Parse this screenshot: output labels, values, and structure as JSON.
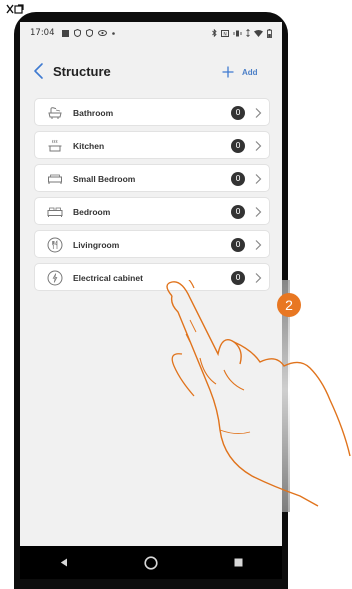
{
  "status_bar": {
    "time": "17:04"
  },
  "header": {
    "title": "Structure",
    "add_label": "Add"
  },
  "rooms": [
    {
      "label": "Bathroom",
      "count": "0",
      "icon": "bathtub-icon"
    },
    {
      "label": "Kitchen",
      "count": "0",
      "icon": "cooking-pot-icon"
    },
    {
      "label": "Small Bedroom",
      "count": "0",
      "icon": "single-bed-icon"
    },
    {
      "label": "Bedroom",
      "count": "0",
      "icon": "double-bed-icon"
    },
    {
      "label": "Livingroom",
      "count": "0",
      "icon": "cutlery-icon"
    },
    {
      "label": "Electrical cabinet",
      "count": "0",
      "icon": "electrical-panel-icon"
    }
  ],
  "step": {
    "number": "2"
  },
  "colors": {
    "accent": "#4b7fc7",
    "step_orange": "#e87722",
    "badge": "#333333"
  }
}
